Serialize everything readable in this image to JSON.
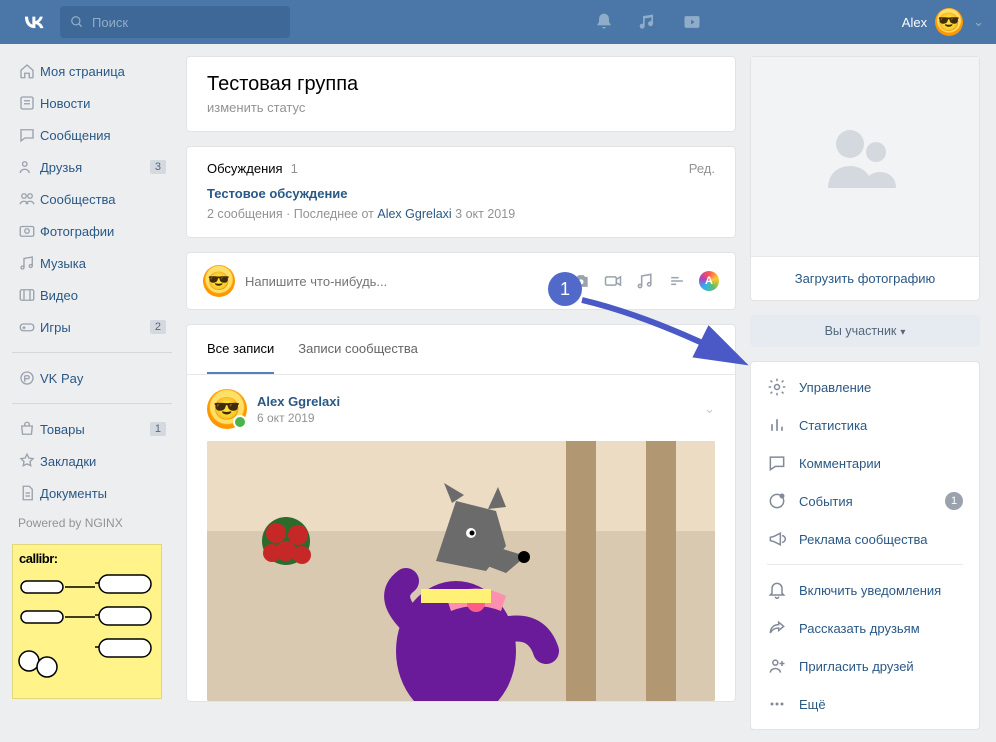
{
  "topbar": {
    "search_placeholder": "Поиск",
    "user_name": "Alex"
  },
  "leftnav": [
    {
      "icon": "home",
      "label": "Моя страница",
      "badge": null
    },
    {
      "icon": "news",
      "label": "Новости",
      "badge": null
    },
    {
      "icon": "messages",
      "label": "Сообщения",
      "badge": null
    },
    {
      "icon": "friends",
      "label": "Друзья",
      "badge": "3"
    },
    {
      "icon": "communities",
      "label": "Сообщества",
      "badge": null
    },
    {
      "icon": "photos",
      "label": "Фотографии",
      "badge": null
    },
    {
      "icon": "music",
      "label": "Музыка",
      "badge": null
    },
    {
      "icon": "video",
      "label": "Видео",
      "badge": null
    },
    {
      "icon": "games",
      "label": "Игры",
      "badge": "2"
    },
    {
      "divider": true
    },
    {
      "icon": "vkpay",
      "label": "VK Pay",
      "badge": null
    },
    {
      "divider": true
    },
    {
      "icon": "market",
      "label": "Товары",
      "badge": "1"
    },
    {
      "icon": "bookmarks",
      "label": "Закладки",
      "badge": null
    },
    {
      "icon": "docs",
      "label": "Документы",
      "badge": null
    }
  ],
  "powered": "Powered by NGINX",
  "ad": {
    "title": "callibr:"
  },
  "group": {
    "title": "Тестовая группа",
    "status": "изменить статус"
  },
  "discussions": {
    "heading": "Обсуждения",
    "count": "1",
    "edit": "Ред.",
    "topic": "Тестовое обсуждение",
    "meta_msgs": "2 сообщения",
    "meta_sep": " · ",
    "meta_last": "Последнее от ",
    "meta_name": "Alex Ggrelaxi",
    "meta_date": " 3 окт 2019"
  },
  "composer": {
    "placeholder": "Напишите что-нибудь..."
  },
  "tabs": {
    "all": "Все записи",
    "community": "Записи сообщества"
  },
  "post": {
    "author": "Alex Ggrelaxi",
    "date": "6 окт 2019"
  },
  "right": {
    "upload": "Загрузить фотографию",
    "member": "Вы участник",
    "management": "Управление",
    "stats": "Статистика",
    "comments": "Комментарии",
    "events": "События",
    "events_badge": "1",
    "ads": "Реклама сообщества",
    "notifications": "Включить уведомления",
    "tell": "Рассказать друзьям",
    "invite": "Пригласить друзей",
    "more": "Ещё"
  },
  "annotation": {
    "number": "1"
  }
}
